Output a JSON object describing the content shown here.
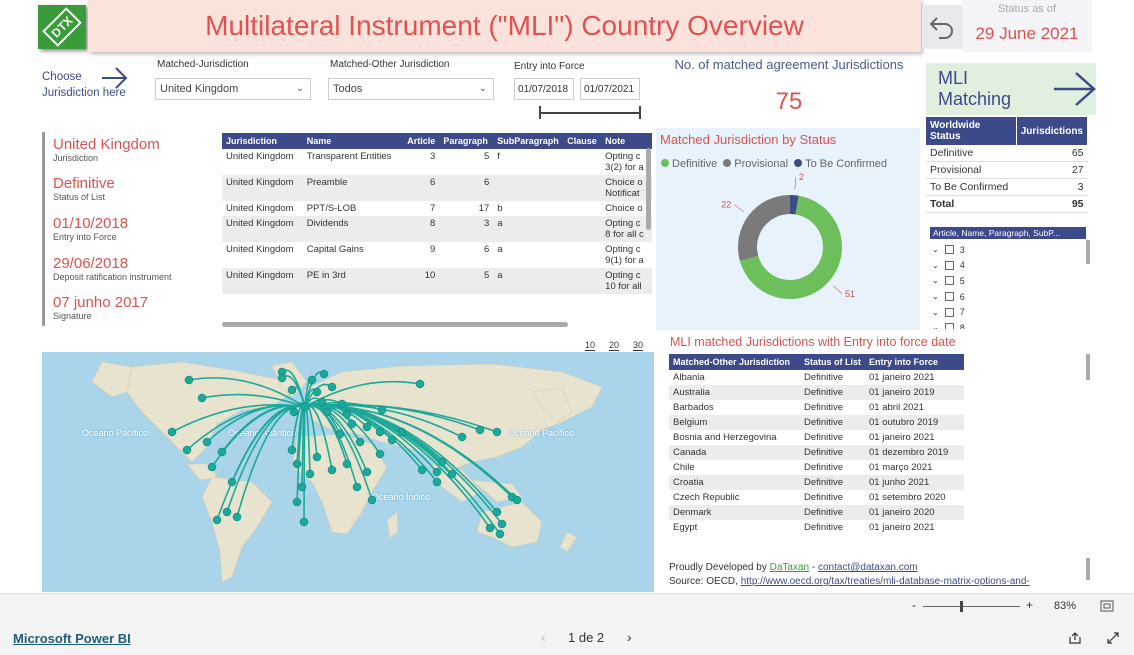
{
  "header": {
    "logo_text": "DTX",
    "title": "Multilateral Instrument (\"MLI\") Country Overview",
    "status_label": "Status as of",
    "status_date": "29 June 2021"
  },
  "filters": {
    "choose_label": "Choose Jurisdiction here",
    "matched_jur_label": "Matched-Jurisdiction",
    "matched_jur_value": "United Kingdom",
    "other_jur_label": "Matched-Other Jurisdiction",
    "other_jur_value": "Todos",
    "entry_label": "Entry into Force",
    "entry_from": "01/07/2018",
    "entry_to": "01/07/2021"
  },
  "kpi": {
    "label": "No. of matched agreement Jurisdictions",
    "value": "75"
  },
  "mli_button": "MLI Matching",
  "info": [
    {
      "value": "United Kingdom",
      "label": "Jurisdiction"
    },
    {
      "value": "Definitive",
      "label": "Status of List"
    },
    {
      "value": "01/10/2018",
      "label": "Entry into Force"
    },
    {
      "value": "29/06/2018",
      "label": "Deposit ratification instrument"
    },
    {
      "value": "07 junho 2017",
      "label": "Signature"
    }
  ],
  "detail_table": {
    "columns": [
      "Jurisdiction",
      "Name",
      "Article",
      "Paragraph",
      "SubParagraph",
      "Clause",
      "Note"
    ],
    "rows": [
      {
        "jur": "United Kingdom",
        "name": "Transparent Entities",
        "article": "3",
        "paragraph": "5",
        "sub": "f",
        "clause": "",
        "note": "Opting c",
        "note2": "3(2) for a"
      },
      {
        "jur": "United Kingdom",
        "name": "Preamble",
        "article": "6",
        "paragraph": "6",
        "sub": "",
        "clause": "",
        "note": "Choice o",
        "note2": "Notificat"
      },
      {
        "jur": "United Kingdom",
        "name": "PPT/S-LOB",
        "article": "7",
        "paragraph": "17",
        "sub": "b",
        "clause": "",
        "note": "Choice o",
        "note2": ""
      },
      {
        "jur": "United Kingdom",
        "name": "Dividends",
        "article": "8",
        "paragraph": "3",
        "sub": "a",
        "clause": "",
        "note": "Opting c",
        "note2": "8 for all c"
      },
      {
        "jur": "United Kingdom",
        "name": "Capital Gains",
        "article": "9",
        "paragraph": "6",
        "sub": "a",
        "clause": "",
        "note": "Opting c",
        "note2": "9(1) for a"
      },
      {
        "jur": "United Kingdom",
        "name": "PE in 3rd",
        "article": "10",
        "paragraph": "5",
        "sub": "a",
        "clause": "",
        "note": "Opting c",
        "note2": "10 for all"
      }
    ]
  },
  "donut": {
    "title": "Matched Jurisdiction by Status",
    "legend": [
      "Definitive",
      "Provisional",
      "To Be Confirmed"
    ],
    "colors": [
      "#6cbf5a",
      "#7a7a7a",
      "#3d4a8a"
    ],
    "values": [
      51,
      22,
      2
    ]
  },
  "status_table": {
    "columns": [
      "Worldwide Status",
      "Jurisdictions"
    ],
    "rows": [
      {
        "s": "Definitive",
        "n": "65"
      },
      {
        "s": "Provisional",
        "n": "27"
      },
      {
        "s": "To Be Confirmed",
        "n": "3"
      }
    ],
    "total_label": "Total",
    "total": "95"
  },
  "slicer": {
    "title": "Article, Name, Paragraph, SubP...",
    "items": [
      "3",
      "4",
      "5",
      "6",
      "7",
      "8"
    ]
  },
  "map": {
    "zoom_levels": [
      "10",
      "20",
      "30"
    ],
    "labels": [
      "Oceano Pacífico",
      "Oceano Atlântico",
      "Oceano Índico",
      "Oceano Pacífico"
    ],
    "point_color": "#1aa99a"
  },
  "entry_table": {
    "title": "MLI matched Jurisdictions with Entry into force date",
    "columns": [
      "Matched-Other Jurisdiction",
      "Status of List",
      "Entry into Force"
    ],
    "rows": [
      {
        "j": "Albania",
        "s": "Definitive",
        "d": "01 janeiro 2021"
      },
      {
        "j": "Australia",
        "s": "Definitive",
        "d": "01 janeiro 2019"
      },
      {
        "j": "Barbados",
        "s": "Definitive",
        "d": "01 abril 2021"
      },
      {
        "j": "Belgium",
        "s": "Definitive",
        "d": "01 outubro 2019"
      },
      {
        "j": "Bosnia and Herzegovina",
        "s": "Definitive",
        "d": "01 janeiro 2021"
      },
      {
        "j": "Canada",
        "s": "Definitive",
        "d": "01 dezembro 2019"
      },
      {
        "j": "Chile",
        "s": "Definitive",
        "d": "01 março 2021"
      },
      {
        "j": "Croatia",
        "s": "Definitive",
        "d": "01 junho 2021"
      },
      {
        "j": "Czech Republic",
        "s": "Definitive",
        "d": "01 setembro 2020"
      },
      {
        "j": "Denmark",
        "s": "Definitive",
        "d": "01 janeiro 2020"
      },
      {
        "j": "Egypt",
        "s": "Definitive",
        "d": "01 janeiro 2021"
      }
    ]
  },
  "credits": {
    "dev_prefix": "Proudly Developed by ",
    "dev_link": "DaTaxan",
    "dev_sep": " - ",
    "email": "contact@dataxan.com",
    "source_prefix": "Source: OECD, ",
    "source_link": "http://www.oecd.org/tax/treaties/mli-database-matrix-options-and-"
  },
  "zoom": {
    "minus": "-",
    "plus": "+",
    "value": "83%"
  },
  "powerbi": {
    "link": "Microsoft Power BI",
    "page": "1 de 2"
  }
}
